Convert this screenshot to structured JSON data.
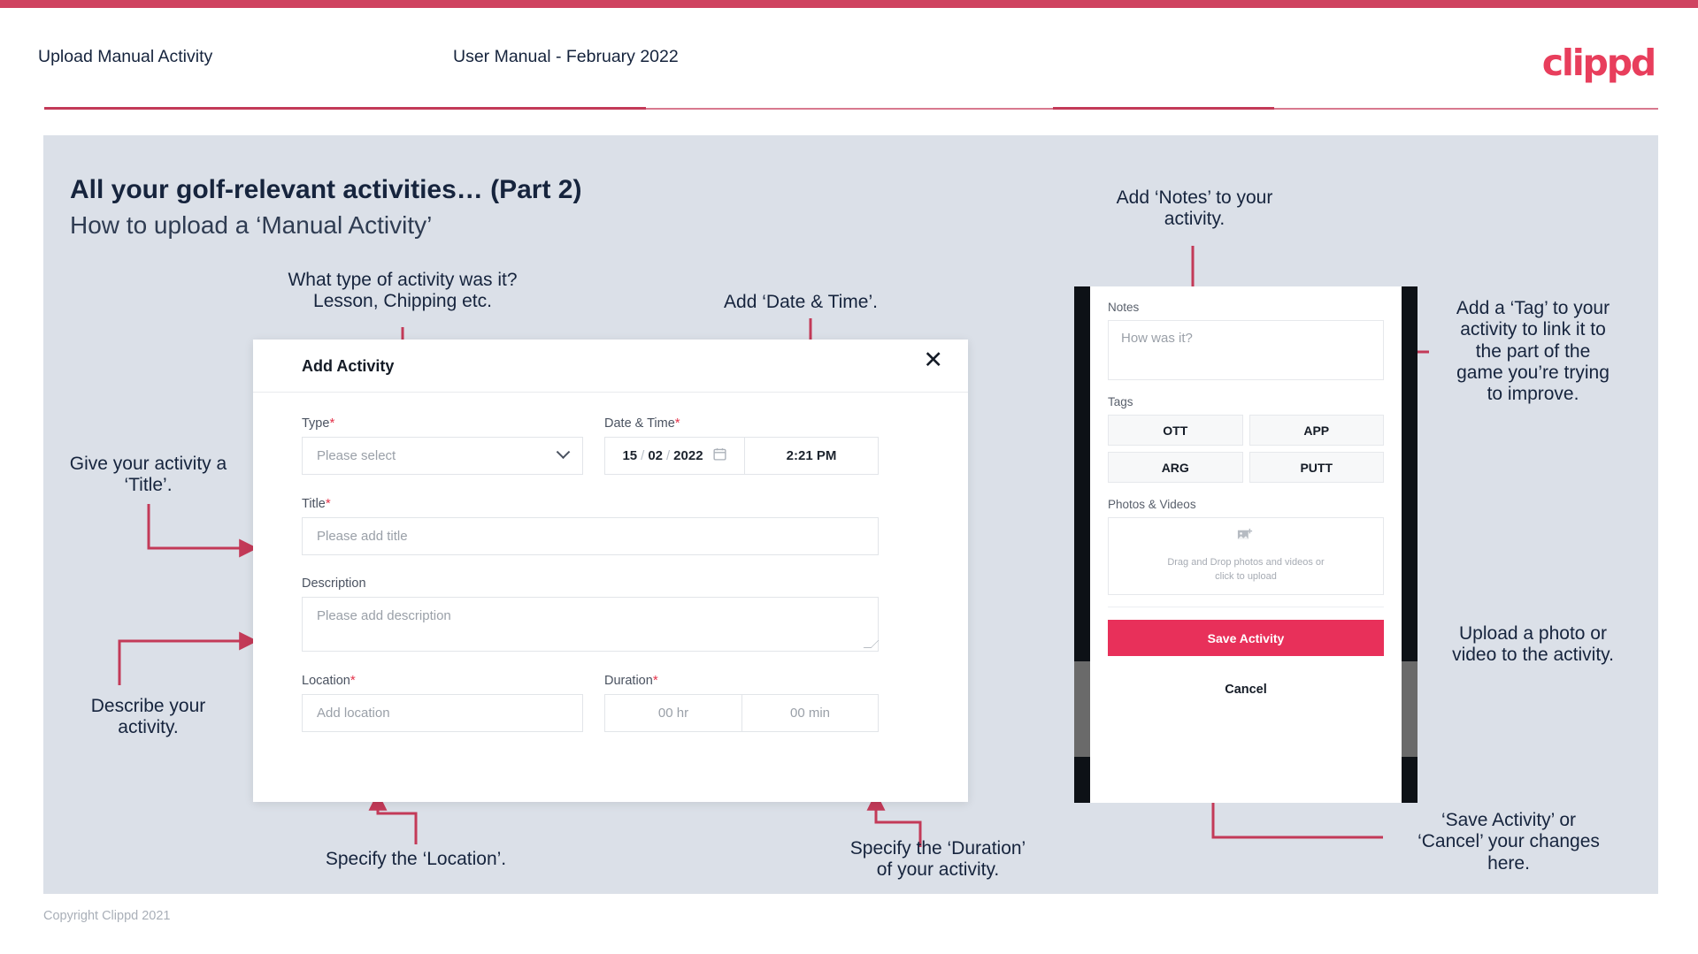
{
  "header": {
    "title": "Upload Manual Activity",
    "subtitle": "User Manual - February 2022",
    "logo": "clippd"
  },
  "slide": {
    "title": "All your golf-relevant activities… (Part 2)",
    "subtitle": "How to upload a ‘Manual Activity’"
  },
  "dialog": {
    "title": "Add Activity",
    "close_icon": "close-icon",
    "type": {
      "label": "Type",
      "required": "*",
      "value": "",
      "placeholder": "Please select",
      "chevron": "chevron-down-icon"
    },
    "datetime": {
      "label": "Date & Time",
      "required": "*",
      "day": "15",
      "sep1": "/",
      "month": "02",
      "sep2": "/",
      "year": "2022",
      "calendar_icon": "calendar-icon",
      "time": "2:21 PM"
    },
    "title_field": {
      "label": "Title",
      "required": "*",
      "value": "",
      "placeholder": "Please add title"
    },
    "description": {
      "label": "Description",
      "required": "",
      "value": "",
      "placeholder": "Please add description"
    },
    "location": {
      "label": "Location",
      "required": "*",
      "value": "",
      "placeholder": "Add location"
    },
    "duration": {
      "label": "Duration",
      "required": "*",
      "hours": "00 hr",
      "minutes": "00 min"
    }
  },
  "phone": {
    "notes": {
      "label": "Notes",
      "placeholder": "How was it?"
    },
    "tags": {
      "label": "Tags",
      "items": [
        "OTT",
        "APP",
        "ARG",
        "PUTT"
      ]
    },
    "photos": {
      "label": "Photos & Videos",
      "icon": "add-image-icon",
      "line1": "Drag and Drop photos and videos or",
      "line2": "click to upload"
    },
    "save_label": "Save Activity",
    "cancel_label": "Cancel"
  },
  "annotations": {
    "type": "What type of activity was it?\nLesson, Chipping etc.",
    "type_l1": "What type of activity was it?",
    "type_l2": "Lesson, Chipping etc.",
    "datetime": "Add ‘Date & Time’.",
    "title_l1": "Give your activity a",
    "title_l2": "‘Title’.",
    "description_l1": "Describe your",
    "description_l2": "activity.",
    "location": "Specify the ‘Location’.",
    "duration_l1": "Specify the ‘Duration’",
    "duration_l2": "of your activity.",
    "notes_l1": "Add ‘Notes’ to your",
    "notes_l2": "activity.",
    "tag_l1": "Add a ‘Tag’ to your",
    "tag_l2": "activity to link it to",
    "tag_l3": "the part of the",
    "tag_l4": "game you’re trying",
    "tag_l5": "to improve.",
    "upload_l1": "Upload a photo or",
    "upload_l2": "video to the activity.",
    "save_l1": "‘Save Activity’ or",
    "save_l2": "‘Cancel’ your changes",
    "save_l3": "here."
  },
  "footer": {
    "copyright": "Copyright Clippd 2021"
  },
  "colors": {
    "accent": "#e8305a",
    "header_bar": "#cf4360",
    "slide_bg": "#dbe0e8",
    "text_dark": "#16243d",
    "arrow": "#c33a58"
  }
}
